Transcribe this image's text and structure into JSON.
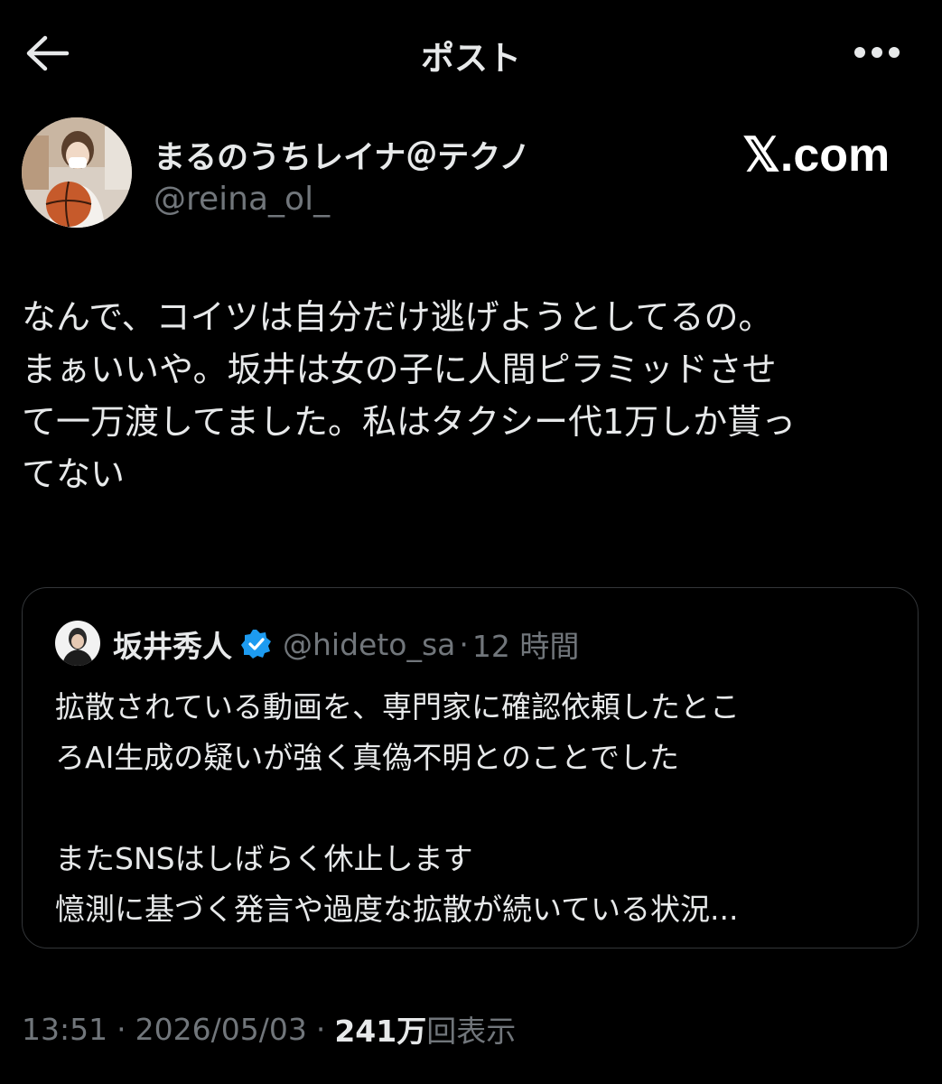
{
  "header": {
    "title": "ポスト",
    "back_icon": "arrow-left-icon",
    "more_icon": "more-horizontal-icon"
  },
  "author": {
    "display_name": "まるのうちレイナ＠テクノ",
    "handle": "@reina_ol_"
  },
  "watermark": "𝕏.com",
  "tweet": {
    "text": "なんで、コイツは自分だけ逃げようとしてるの。\nまぁいいや。坂井は女の子に人間ピラミッドさせ\nて一万渡してました。私はタクシー代1万しか貰っ\nてない"
  },
  "quote": {
    "display_name": "坂井秀人",
    "verified_icon": "verified-badge-icon",
    "handle": "@hideto_sa",
    "separator": "·",
    "time": "12 時間",
    "text": "拡散されている動画を、専門家に確認依頼したとこ\nろAI生成の疑いが強く真偽不明とのことでした\n\nまたSNSはしばらく休止します\n憶測に基づく発言や過度な拡散が続いている状況..."
  },
  "meta": {
    "time": "13:51",
    "date": "2026/05/03",
    "separator": "·",
    "views": "241万",
    "views_label": "回表示"
  },
  "colors": {
    "background": "#000000",
    "text_primary": "#e7e9ea",
    "text_secondary": "#71767b",
    "border": "#333639",
    "verified": "#1d9bf0"
  }
}
